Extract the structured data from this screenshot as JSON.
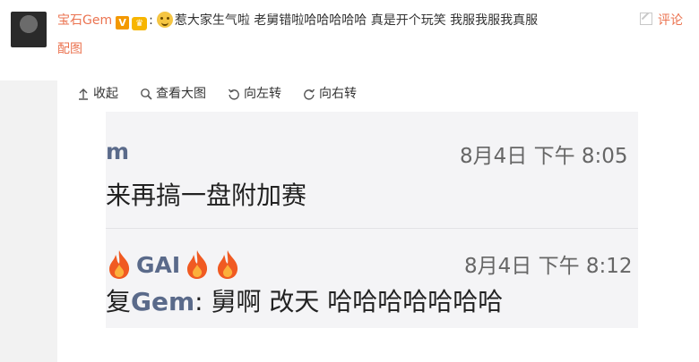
{
  "comment": {
    "username": "宝石Gem",
    "vip_badge": "V",
    "crown_badge": "♛",
    "colon": ":",
    "text": "惹大家生气啦 老舅错啦哈哈哈哈哈 真是开个玩笑 我服我服我真服",
    "reply_label": "评论",
    "pic_label": "配图"
  },
  "toolbar": {
    "collapse": "收起",
    "view_large": "查看大图",
    "rotate_left": "向左转",
    "rotate_right": "向右转"
  },
  "screenshot": {
    "message1": {
      "sender_partial": "m",
      "time": "8月4日 下午 8:05",
      "text_partial": "来再搞一盘附加赛"
    },
    "message2": {
      "sender_name": "GAI",
      "time": "8月4日 下午 8:12",
      "reply_prefix_partial": "复",
      "mention": "Gem",
      "text": ": 舅啊 改天 哈哈哈哈哈哈哈"
    }
  },
  "colors": {
    "accent": "#eb7350",
    "background": "#f2f2f2",
    "link_blue_gray": "#5a6a8a"
  }
}
